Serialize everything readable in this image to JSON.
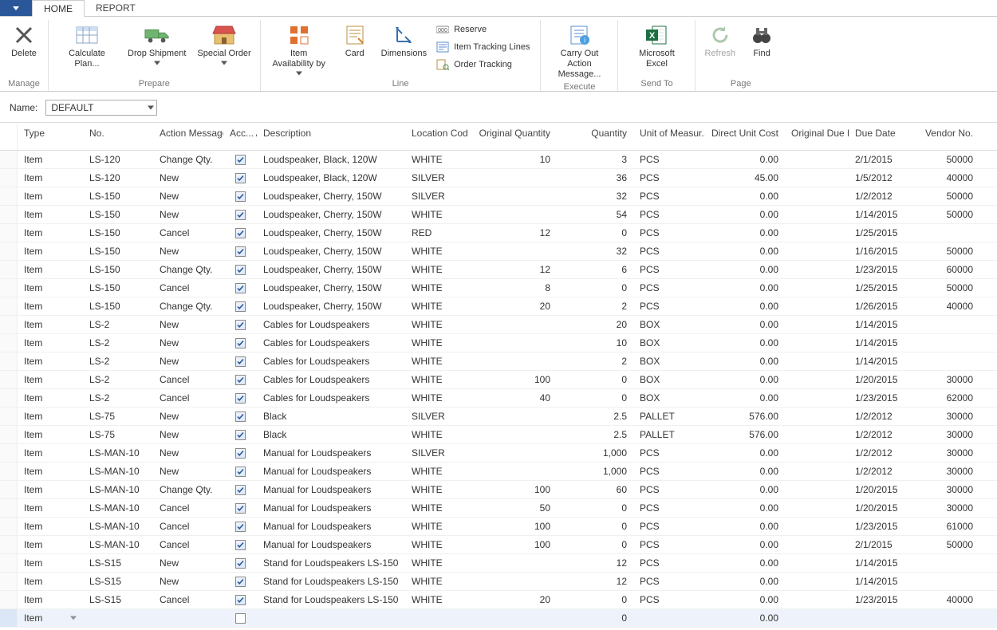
{
  "tabs": {
    "home": "HOME",
    "report": "REPORT"
  },
  "ribbon": {
    "delete": "Delete",
    "manage_group": "Manage",
    "calc_plan": "Calculate Plan...",
    "drop_ship": "Drop Shipment",
    "special_order": "Special Order",
    "prepare_group": "Prepare",
    "item_avail": "Item Availability by",
    "card": "Card",
    "dimensions": "Dimensions",
    "reserve": "Reserve",
    "tracking_lines": "Item Tracking Lines",
    "order_tracking": "Order Tracking",
    "line_group": "Line",
    "carry_out": "Carry Out Action Message...",
    "execute_group": "Execute",
    "excel": "Microsoft Excel",
    "sendto_group": "Send To",
    "refresh": "Refresh",
    "find": "Find",
    "page_group": "Page"
  },
  "name_bar": {
    "label": "Name:",
    "value": "DEFAULT"
  },
  "columns": {
    "type": "Type",
    "no": "No.",
    "action": "Action Message",
    "accept": "Acc... Acti...",
    "desc": "Description",
    "loc": "Location Code",
    "oqty": "Original Quantity",
    "qty": "Quantity",
    "uom": "Unit of Measur...",
    "cost": "Direct Unit Cost",
    "odate": "Original Due Date",
    "due": "Due Date",
    "vendor": "Vendor No."
  },
  "rows": [
    {
      "type": "Item",
      "no": "LS-120",
      "action": "Change Qty.",
      "accept": true,
      "desc": "Loudspeaker, Black, 120W",
      "loc": "WHITE",
      "oqty": "10",
      "qty": "3",
      "uom": "PCS",
      "cost": "0.00",
      "odate": "",
      "due": "2/1/2015",
      "vendor": "50000"
    },
    {
      "type": "Item",
      "no": "LS-120",
      "action": "New",
      "accept": true,
      "desc": "Loudspeaker, Black, 120W",
      "loc": "SILVER",
      "oqty": "",
      "qty": "36",
      "uom": "PCS",
      "cost": "45.00",
      "odate": "",
      "due": "1/5/2012",
      "vendor": "40000"
    },
    {
      "type": "Item",
      "no": "LS-150",
      "action": "New",
      "accept": true,
      "desc": "Loudspeaker, Cherry, 150W",
      "loc": "SILVER",
      "oqty": "",
      "qty": "32",
      "uom": "PCS",
      "cost": "0.00",
      "odate": "",
      "due": "1/2/2012",
      "vendor": "50000"
    },
    {
      "type": "Item",
      "no": "LS-150",
      "action": "New",
      "accept": true,
      "desc": "Loudspeaker, Cherry, 150W",
      "loc": "WHITE",
      "oqty": "",
      "qty": "54",
      "uom": "PCS",
      "cost": "0.00",
      "odate": "",
      "due": "1/14/2015",
      "vendor": "50000"
    },
    {
      "type": "Item",
      "no": "LS-150",
      "action": "Cancel",
      "accept": true,
      "desc": "Loudspeaker, Cherry, 150W",
      "loc": "RED",
      "oqty": "12",
      "qty": "0",
      "uom": "PCS",
      "cost": "0.00",
      "odate": "",
      "due": "1/25/2015",
      "vendor": ""
    },
    {
      "type": "Item",
      "no": "LS-150",
      "action": "New",
      "accept": true,
      "desc": "Loudspeaker, Cherry, 150W",
      "loc": "WHITE",
      "oqty": "",
      "qty": "32",
      "uom": "PCS",
      "cost": "0.00",
      "odate": "",
      "due": "1/16/2015",
      "vendor": "50000"
    },
    {
      "type": "Item",
      "no": "LS-150",
      "action": "Change Qty.",
      "accept": true,
      "desc": "Loudspeaker, Cherry, 150W",
      "loc": "WHITE",
      "oqty": "12",
      "qty": "6",
      "uom": "PCS",
      "cost": "0.00",
      "odate": "",
      "due": "1/23/2015",
      "vendor": "60000"
    },
    {
      "type": "Item",
      "no": "LS-150",
      "action": "Cancel",
      "accept": true,
      "desc": "Loudspeaker, Cherry, 150W",
      "loc": "WHITE",
      "oqty": "8",
      "qty": "0",
      "uom": "PCS",
      "cost": "0.00",
      "odate": "",
      "due": "1/25/2015",
      "vendor": "50000"
    },
    {
      "type": "Item",
      "no": "LS-150",
      "action": "Change Qty.",
      "accept": true,
      "desc": "Loudspeaker, Cherry, 150W",
      "loc": "WHITE",
      "oqty": "20",
      "qty": "2",
      "uom": "PCS",
      "cost": "0.00",
      "odate": "",
      "due": "1/26/2015",
      "vendor": "40000"
    },
    {
      "type": "Item",
      "no": "LS-2",
      "action": "New",
      "accept": true,
      "desc": "Cables for Loudspeakers",
      "loc": "WHITE",
      "oqty": "",
      "qty": "20",
      "uom": "BOX",
      "cost": "0.00",
      "odate": "",
      "due": "1/14/2015",
      "vendor": ""
    },
    {
      "type": "Item",
      "no": "LS-2",
      "action": "New",
      "accept": true,
      "desc": "Cables for Loudspeakers",
      "loc": "WHITE",
      "oqty": "",
      "qty": "10",
      "uom": "BOX",
      "cost": "0.00",
      "odate": "",
      "due": "1/14/2015",
      "vendor": ""
    },
    {
      "type": "Item",
      "no": "LS-2",
      "action": "New",
      "accept": true,
      "desc": "Cables for Loudspeakers",
      "loc": "WHITE",
      "oqty": "",
      "qty": "2",
      "uom": "BOX",
      "cost": "0.00",
      "odate": "",
      "due": "1/14/2015",
      "vendor": ""
    },
    {
      "type": "Item",
      "no": "LS-2",
      "action": "Cancel",
      "accept": true,
      "desc": "Cables for Loudspeakers",
      "loc": "WHITE",
      "oqty": "100",
      "qty": "0",
      "uom": "BOX",
      "cost": "0.00",
      "odate": "",
      "due": "1/20/2015",
      "vendor": "30000"
    },
    {
      "type": "Item",
      "no": "LS-2",
      "action": "Cancel",
      "accept": true,
      "desc": "Cables for Loudspeakers",
      "loc": "WHITE",
      "oqty": "40",
      "qty": "0",
      "uom": "BOX",
      "cost": "0.00",
      "odate": "",
      "due": "1/23/2015",
      "vendor": "62000"
    },
    {
      "type": "Item",
      "no": "LS-75",
      "action": "New",
      "accept": true,
      "desc": "Black",
      "loc": "SILVER",
      "oqty": "",
      "qty": "2.5",
      "uom": "PALLET",
      "cost": "576.00",
      "odate": "",
      "due": "1/2/2012",
      "vendor": "30000"
    },
    {
      "type": "Item",
      "no": "LS-75",
      "action": "New",
      "accept": true,
      "desc": "Black",
      "loc": "WHITE",
      "oqty": "",
      "qty": "2.5",
      "uom": "PALLET",
      "cost": "576.00",
      "odate": "",
      "due": "1/2/2012",
      "vendor": "30000"
    },
    {
      "type": "Item",
      "no": "LS-MAN-10",
      "action": "New",
      "accept": true,
      "desc": "Manual for Loudspeakers",
      "loc": "SILVER",
      "oqty": "",
      "qty": "1,000",
      "uom": "PCS",
      "cost": "0.00",
      "odate": "",
      "due": "1/2/2012",
      "vendor": "30000"
    },
    {
      "type": "Item",
      "no": "LS-MAN-10",
      "action": "New",
      "accept": true,
      "desc": "Manual for Loudspeakers",
      "loc": "WHITE",
      "oqty": "",
      "qty": "1,000",
      "uom": "PCS",
      "cost": "0.00",
      "odate": "",
      "due": "1/2/2012",
      "vendor": "30000"
    },
    {
      "type": "Item",
      "no": "LS-MAN-10",
      "action": "Change Qty.",
      "accept": true,
      "desc": "Manual for Loudspeakers",
      "loc": "WHITE",
      "oqty": "100",
      "qty": "60",
      "uom": "PCS",
      "cost": "0.00",
      "odate": "",
      "due": "1/20/2015",
      "vendor": "30000"
    },
    {
      "type": "Item",
      "no": "LS-MAN-10",
      "action": "Cancel",
      "accept": true,
      "desc": "Manual for Loudspeakers",
      "loc": "WHITE",
      "oqty": "50",
      "qty": "0",
      "uom": "PCS",
      "cost": "0.00",
      "odate": "",
      "due": "1/20/2015",
      "vendor": "30000"
    },
    {
      "type": "Item",
      "no": "LS-MAN-10",
      "action": "Cancel",
      "accept": true,
      "desc": "Manual for Loudspeakers",
      "loc": "WHITE",
      "oqty": "100",
      "qty": "0",
      "uom": "PCS",
      "cost": "0.00",
      "odate": "",
      "due": "1/23/2015",
      "vendor": "61000"
    },
    {
      "type": "Item",
      "no": "LS-MAN-10",
      "action": "Cancel",
      "accept": true,
      "desc": "Manual for Loudspeakers",
      "loc": "WHITE",
      "oqty": "100",
      "qty": "0",
      "uom": "PCS",
      "cost": "0.00",
      "odate": "",
      "due": "2/1/2015",
      "vendor": "50000"
    },
    {
      "type": "Item",
      "no": "LS-S15",
      "action": "New",
      "accept": true,
      "desc": "Stand for Loudspeakers LS-150",
      "loc": "WHITE",
      "oqty": "",
      "qty": "12",
      "uom": "PCS",
      "cost": "0.00",
      "odate": "",
      "due": "1/14/2015",
      "vendor": ""
    },
    {
      "type": "Item",
      "no": "LS-S15",
      "action": "New",
      "accept": true,
      "desc": "Stand for Loudspeakers LS-150",
      "loc": "WHITE",
      "oqty": "",
      "qty": "12",
      "uom": "PCS",
      "cost": "0.00",
      "odate": "",
      "due": "1/14/2015",
      "vendor": ""
    },
    {
      "type": "Item",
      "no": "LS-S15",
      "action": "Cancel",
      "accept": true,
      "desc": "Stand for Loudspeakers LS-150",
      "loc": "WHITE",
      "oqty": "20",
      "qty": "0",
      "uom": "PCS",
      "cost": "0.00",
      "odate": "",
      "due": "1/23/2015",
      "vendor": "40000"
    }
  ],
  "edit_row": {
    "type": "Item",
    "qty": "0",
    "cost": "0.00"
  }
}
